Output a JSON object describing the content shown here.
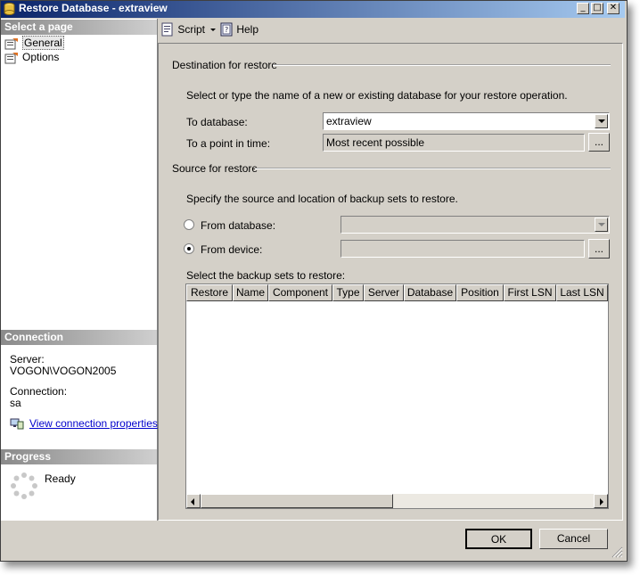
{
  "window": {
    "title": "Restore Database - extraview",
    "minimize": "_",
    "maximize": "□",
    "close": "✕"
  },
  "left_pane": {
    "select_page_header": "Select a page",
    "pages": [
      {
        "label": "General",
        "icon": "page-icon",
        "selected": true
      },
      {
        "label": "Options",
        "icon": "page-icon",
        "selected": false
      }
    ],
    "connection_header": "Connection",
    "server_label": "Server:",
    "server_value": "VOGON\\VOGON2005",
    "connection_label": "Connection:",
    "connection_value": "sa",
    "view_connection_link": "View connection properties",
    "progress_header": "Progress",
    "progress_status": "Ready"
  },
  "toolbar": {
    "script_label": "Script",
    "help_label": "Help"
  },
  "destination": {
    "group_label": "Destination for restore",
    "instruction": "Select or type the name of a new or existing database for your restore operation.",
    "to_database_label": "To database:",
    "to_database_value": "extraview",
    "point_in_time_label": "To a point in time:",
    "point_in_time_value": "Most recent possible",
    "browse_button": "..."
  },
  "source": {
    "group_label": "Source for restore",
    "instruction": "Specify the source and location of backup sets to restore.",
    "from_database_label": "From database:",
    "from_database_value": "",
    "from_device_label": "From device:",
    "from_device_value": "",
    "selected_option": "from_device",
    "browse_button": "...",
    "backup_sets_label": "Select the backup sets to restore:",
    "columns": [
      "Restore",
      "Name",
      "Component",
      "Type",
      "Server",
      "Database",
      "Position",
      "First LSN",
      "Last LSN"
    ]
  },
  "footer": {
    "ok_button": "OK",
    "cancel_button": "Cancel"
  }
}
